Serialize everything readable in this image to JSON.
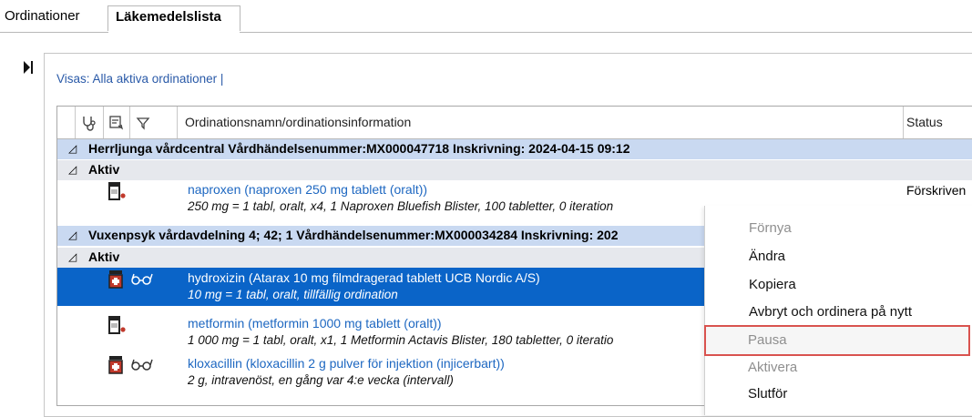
{
  "tabs": [
    {
      "label": "Ordinationer"
    },
    {
      "label": "Läkemedelslista"
    }
  ],
  "filter": {
    "text": "Visas: Alla aktiva ordinationer  |"
  },
  "grid": {
    "columns": {
      "name": "Ordinationsnamn/ordinationsinformation",
      "status": "Status"
    },
    "icon_columns": [
      "stethoscope-icon",
      "note-icon",
      "filter-icon"
    ]
  },
  "groups": [
    {
      "text": "Herrljunga vårdcentral  Vårdhändelsenummer:MX000047718  Inskrivning: 2024-04-15 09:12"
    },
    {
      "text": "Aktiv"
    },
    {
      "text": "Vuxenpsyk vårdavdelning 4; 42; 1  Vårdhändelsenummer:MX000034284  Inskrivning: 202"
    },
    {
      "text": "Aktiv"
    }
  ],
  "rows": [
    {
      "name": "naproxen (naproxen 250 mg tablett (oralt))",
      "info": "250 mg = 1 tabl, oralt, x4, 1 Naproxen Bluefish Blister, 100 tabletter, 0 iteration",
      "status": "Förskriven",
      "icons": [
        "pill-bottle-icon"
      ]
    },
    {
      "name": "hydroxizin (Atarax 10 mg filmdragerad tablett UCB Nordic A/S)",
      "info": "10 mg = 1 tabl, oralt, tillfällig ordination",
      "status": "",
      "icons": [
        "pill-bottle-red-icon",
        "glasses-icon"
      ],
      "selected": true
    },
    {
      "name": "metformin (metformin 1000 mg tablett (oralt))",
      "info": "1 000 mg = 1 tabl, oralt, x1, 1 Metformin Actavis Blister, 180 tabletter, 0 iteratio",
      "status": "",
      "icons": [
        "pill-bottle-icon"
      ]
    },
    {
      "name": "kloxacillin (kloxacillin 2 g pulver för injektion (injicerbart))",
      "info": "2 g, intravenöst, en gång var 4:e vecka (intervall)",
      "status": "",
      "icons": [
        "pill-bottle-red-icon",
        "glasses-icon"
      ]
    }
  ],
  "context_menu": {
    "items": [
      {
        "label": "Förnya",
        "enabled": false
      },
      {
        "label": "Ändra",
        "enabled": true
      },
      {
        "label": "Kopiera",
        "enabled": true
      },
      {
        "label": "Avbryt och ordinera på nytt",
        "enabled": true
      },
      {
        "label": "Pausa",
        "enabled": false,
        "highlighted": true
      },
      {
        "label": "Aktivera",
        "enabled": false
      },
      {
        "label": "Slutför",
        "enabled": true
      }
    ]
  },
  "colors": {
    "selection": "#0a64c8",
    "link": "#1d67c1",
    "highlight_border": "#d9534f"
  }
}
